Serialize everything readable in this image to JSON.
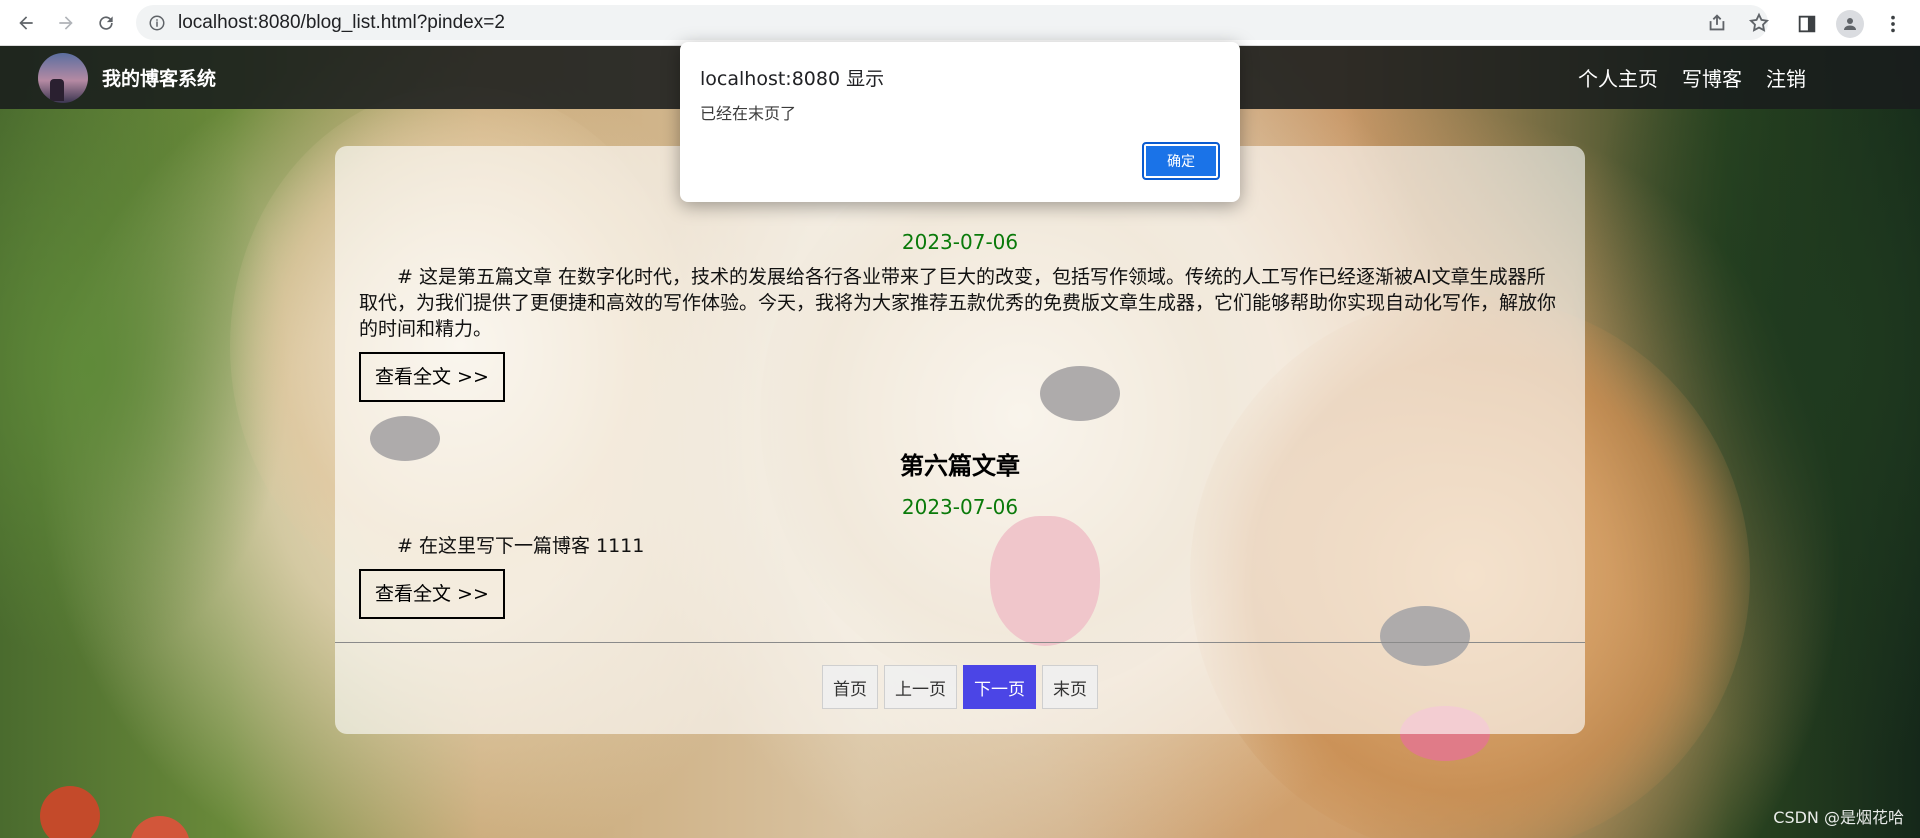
{
  "browser": {
    "url": "localhost:8080/blog_list.html?pindex=2"
  },
  "site": {
    "title": "我的博客系统",
    "nav": [
      "个人主页",
      "写博客",
      "注销"
    ]
  },
  "blogs": [
    {
      "title": "",
      "date": "2023-07-06",
      "desc": "# 这是第五篇文章 在数字化时代，技术的发展给各行各业带来了巨大的改变，包括写作领域。传统的人工写作已经逐渐被AI文章生成器所取代，为我们提供了更便捷和高效的写作体验。今天，我将为大家推荐五款优秀的免费版文章生成器，它们能够帮助你实现自动化写作，解放你的时间和精力。",
      "read_more": "查看全文 >>"
    },
    {
      "title": "第六篇文章",
      "date": "2023-07-06",
      "desc": "# 在这里写下一篇博客 1111",
      "read_more": "查看全文 >>"
    }
  ],
  "pager": {
    "first": "首页",
    "prev": "上一页",
    "next": "下一页",
    "last": "末页"
  },
  "dialog": {
    "title": "localhost:8080 显示",
    "message": "已经在末页了",
    "ok": "确定"
  },
  "watermark": "CSDN @是烟花哈"
}
